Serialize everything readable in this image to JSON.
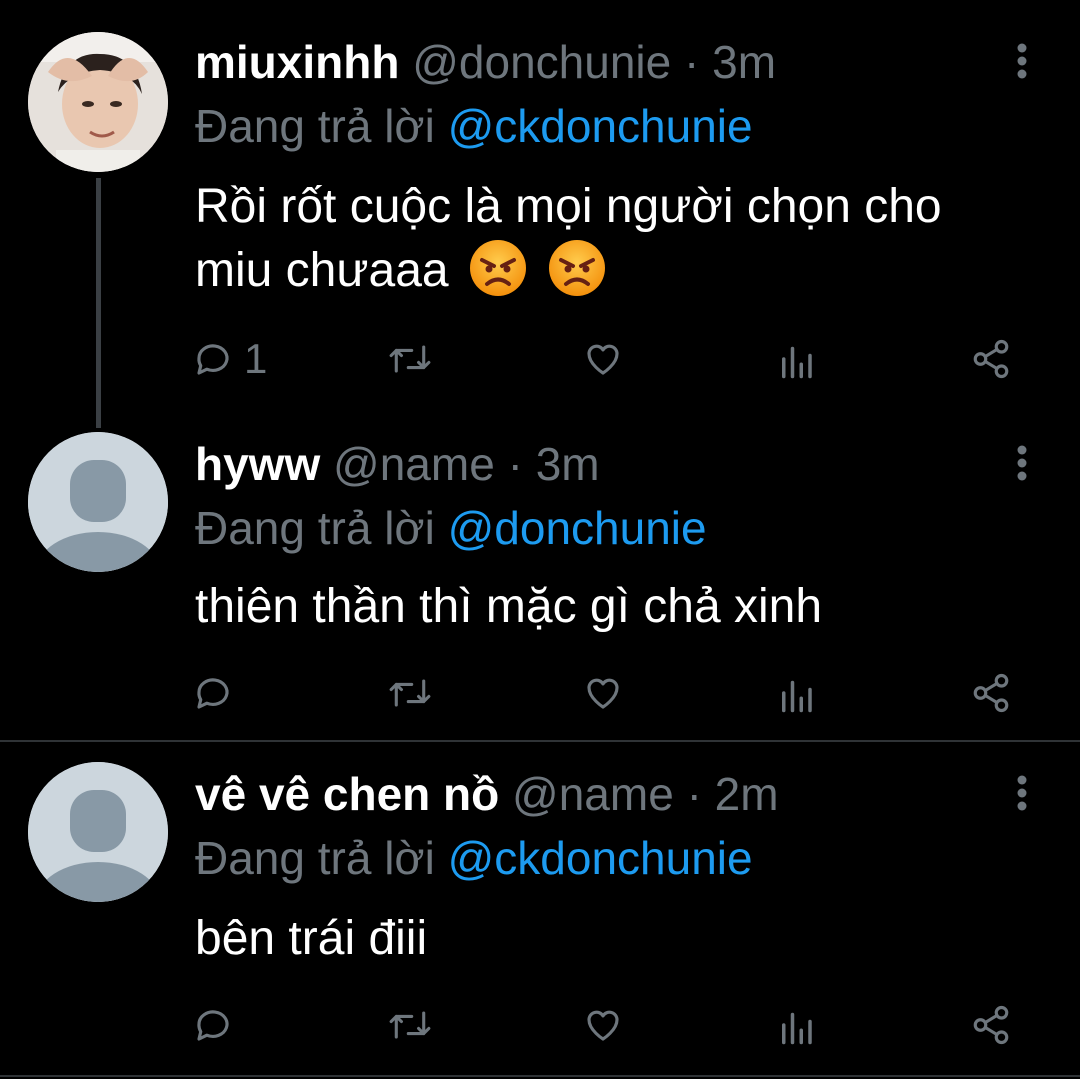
{
  "tweets": [
    {
      "name": "miuxinhh",
      "handle": "@donchunie",
      "separator": "·",
      "time": "3m",
      "replying_prefix": "Đang trả lời",
      "replying_to": "@ckdonchunie",
      "text_line1": "Rồi rốt cuộc là mọi người chọn cho",
      "text_line2": "miu chưaaa",
      "emojis": [
        "angry-face-emoji",
        "angry-face-emoji"
      ],
      "reply_count": "1",
      "avatar": "profile-photo"
    },
    {
      "name": "hyww",
      "handle": "@name",
      "separator": "·",
      "time": "3m",
      "replying_prefix": "Đang trả lời",
      "replying_to": "@donchunie",
      "text": "thiên thần thì mặc gì chả xinh",
      "reply_count": "",
      "avatar": "default-avatar"
    },
    {
      "name": "vê vê chen nồ",
      "handle": "@name",
      "separator": "·",
      "time": "2m",
      "replying_prefix": "Đang trả lời",
      "replying_to": "@ckdonchunie",
      "text": "bên trái điii",
      "reply_count": "",
      "avatar": "default-avatar"
    }
  ],
  "icons": {
    "reply": "reply-icon",
    "retweet": "retweet-icon",
    "like": "heart-icon",
    "analytics": "analytics-icon",
    "share": "share-icon",
    "more": "more-vertical-icon"
  },
  "colors": {
    "background": "#000000",
    "name": "#ffffff",
    "secondary": "#6e767d",
    "mention": "#1d9bf0",
    "avatar_default": "#ccd6dd",
    "avatar_silhouette": "#8899a6",
    "divider": "#2f3336"
  }
}
